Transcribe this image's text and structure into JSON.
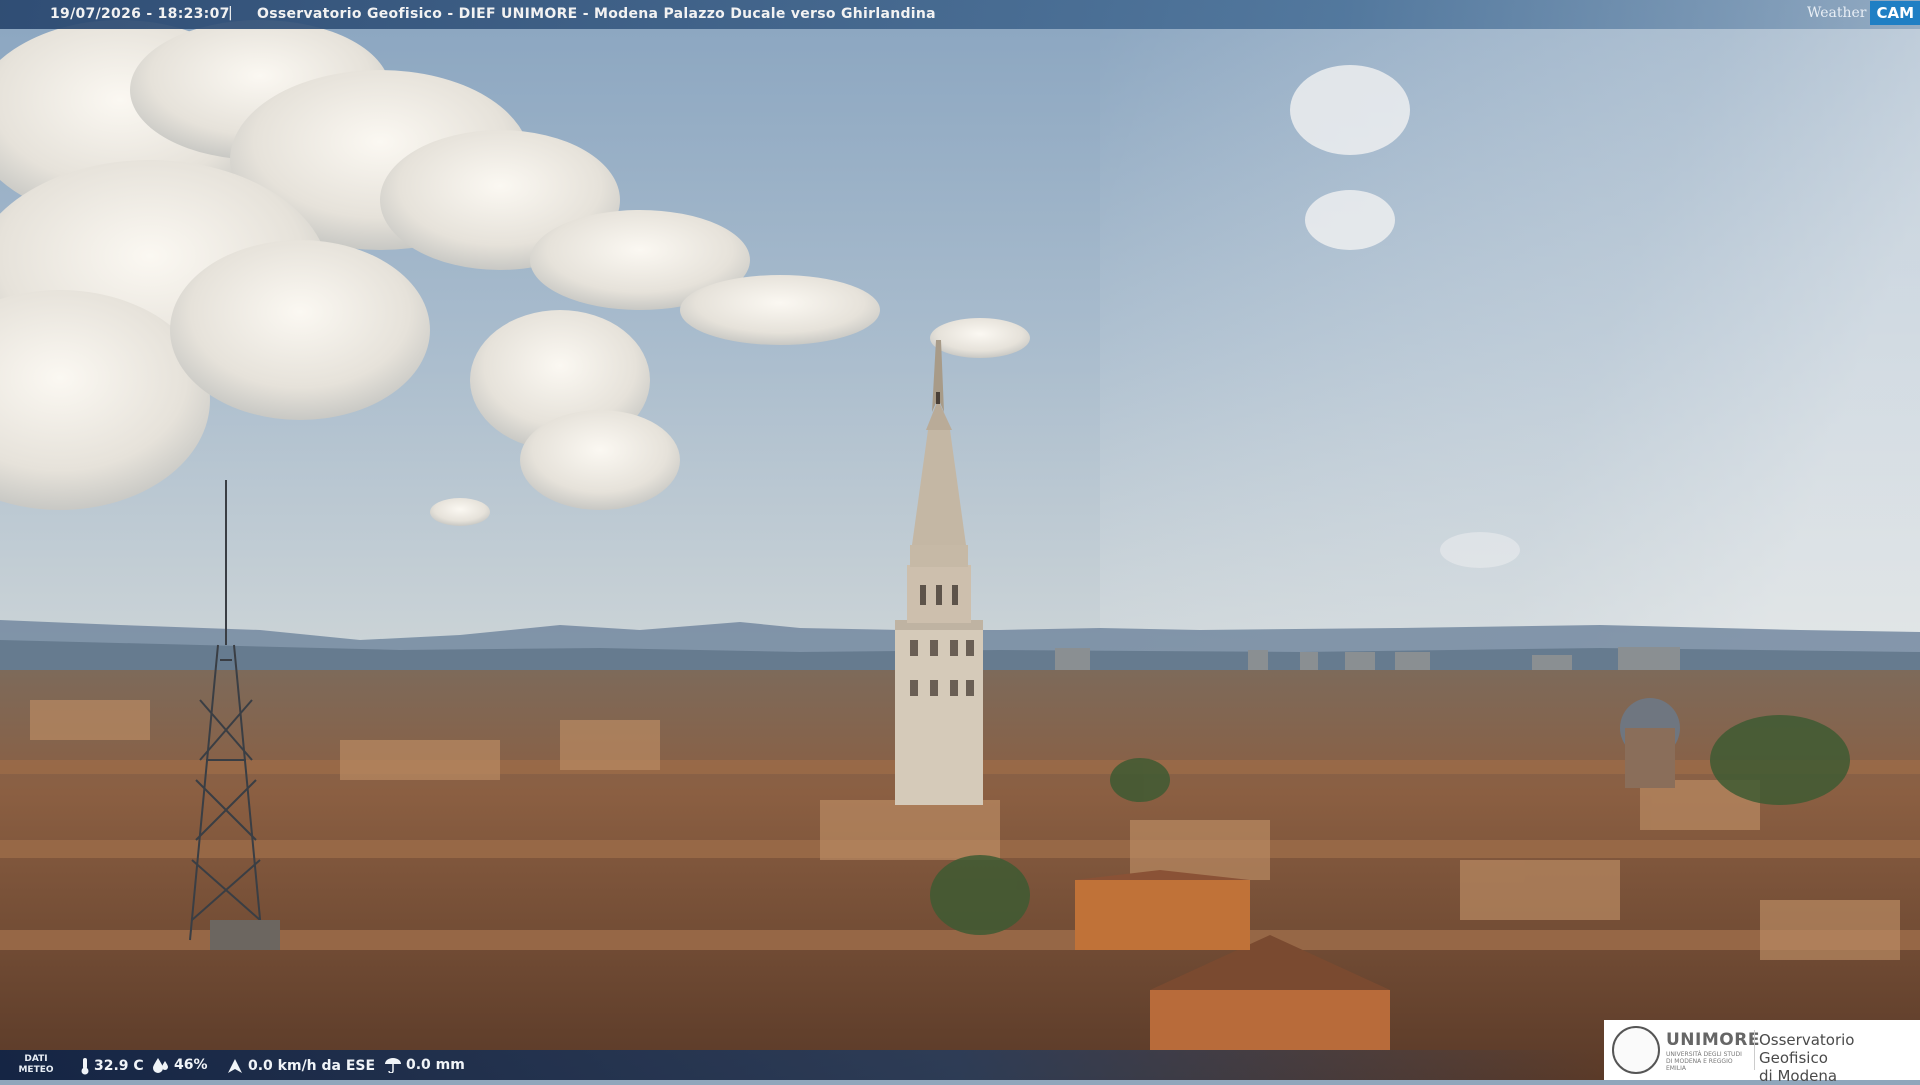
{
  "overlay": {
    "timestamp": "19/07/2026 - 18:23:07",
    "separator": "|",
    "title": "Osservatorio Geofisico - DIEF UNIMORE - Modena Palazzo Ducale verso Ghirlandina",
    "logo_weather": "Weather",
    "logo_cam": "CAM"
  },
  "weather": {
    "label_line1": "DATI",
    "label_line2": "METEO",
    "temperature": "32.9 C",
    "humidity": "46%",
    "wind": "0.0 km/h da ESE",
    "rain": "0.0 mm",
    "icons": [
      "thermometer-icon",
      "humidity-drop-icon",
      "wind-icon",
      "rain-gauge-icon"
    ]
  },
  "branding": {
    "university": "UNIMORE",
    "university_sub": "UNIVERSITÀ DEGLI STUDI DI MODENA E REGGIO EMILIA",
    "observatory_line1": "Osservatorio Geofisico",
    "observatory_line2": "di Modena"
  },
  "colors": {
    "sky_top": "#8ea8c2",
    "sky_horizon": "#c9d2d6",
    "roof": "#8a5a3c",
    "tower": "#cfc4b4",
    "accent_unimore": "#e07a2a",
    "weathercam_blue": "#1f7fc4"
  }
}
